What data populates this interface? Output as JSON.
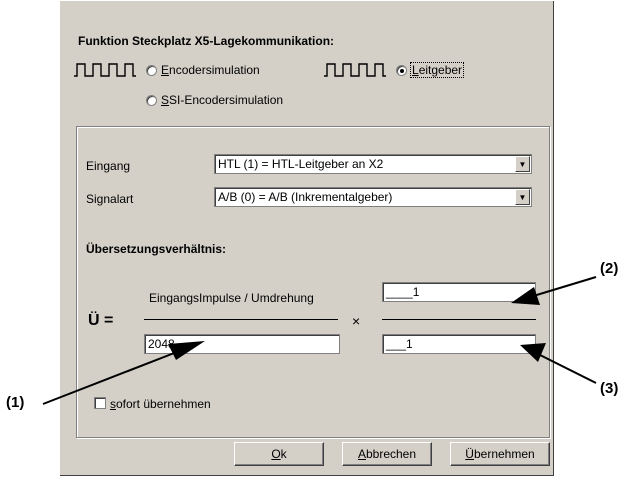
{
  "dialog": {
    "title": "Funktion Steckplatz X5-Lagekommunikation:",
    "mode_options": [
      {
        "label_prefix": "",
        "mnemonic": "E",
        "label_rest": "ncodersimulation",
        "checked": false
      },
      {
        "label_prefix": "",
        "mnemonic": "L",
        "label_rest": "eitgeber",
        "checked": true
      },
      {
        "label_prefix": "",
        "mnemonic": "S",
        "label_rest": "SI-Encodersimulation",
        "checked": false
      }
    ],
    "eingang": {
      "label": "Eingang",
      "value": "HTL (1) = HTL-Leitgeber an X2"
    },
    "signalart": {
      "label": "Signalart",
      "value": "A/B (0) = A/B (Inkrementalgeber)"
    },
    "ratio_heading": "Übersetzungsverhältnis:",
    "ratio_symbol": "Ü =",
    "pulses_label": "EingangsImpulse / Umdrehung",
    "pulses_value": "2048",
    "times_symbol": "×",
    "numerator_value": "____1",
    "denominator_value": "___1",
    "sofort": {
      "mnemonic": "s",
      "label_rest": "ofort übernehmen",
      "checked": false
    },
    "buttons": {
      "ok": {
        "mnemonic": "O",
        "rest": "k"
      },
      "abbrechen": {
        "mnemonic": "A",
        "rest": "bbrechen"
      },
      "uebernehmen": {
        "mnemonic": "Ü",
        "rest": "bernehmen"
      }
    }
  },
  "callouts": {
    "one": "(1)",
    "two": "(2)",
    "three": "(3)"
  }
}
